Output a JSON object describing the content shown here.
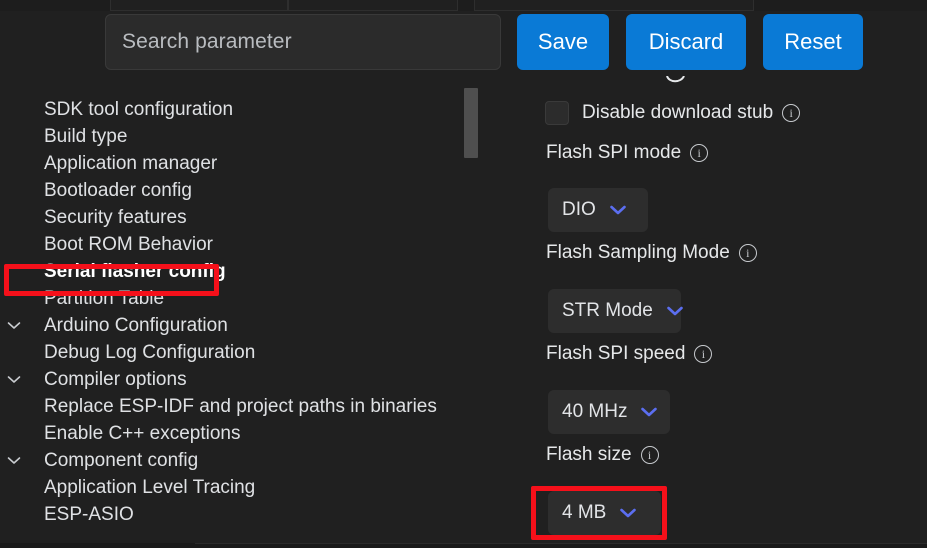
{
  "window": {
    "background": "#202020",
    "accent_blue": "#0a7ad6",
    "chevron_blue": "#5b6ef0",
    "annotation_red": "#f5101a"
  },
  "search": {
    "placeholder": "Search parameter",
    "value": ""
  },
  "toolbar": {
    "save_label": "Save",
    "discard_label": "Discard",
    "reset_label": "Reset"
  },
  "sidebar": {
    "items": [
      {
        "label": "SDK tool configuration",
        "level": 1,
        "twisty": "none",
        "selected": false
      },
      {
        "label": "Build type",
        "level": 1,
        "twisty": "none",
        "selected": false
      },
      {
        "label": "Application manager",
        "level": 1,
        "twisty": "none",
        "selected": false
      },
      {
        "label": "Bootloader config",
        "level": 1,
        "twisty": "none",
        "selected": false
      },
      {
        "label": "Security features",
        "level": 1,
        "twisty": "none",
        "selected": false
      },
      {
        "label": "Boot ROM Behavior",
        "level": 1,
        "twisty": "none",
        "selected": false
      },
      {
        "label": "Serial flasher config",
        "level": 1,
        "twisty": "none",
        "selected": true
      },
      {
        "label": "Partition Table",
        "level": 1,
        "twisty": "none",
        "selected": false
      },
      {
        "label": "Arduino Configuration",
        "level": 0,
        "twisty": "chevron-down",
        "selected": false
      },
      {
        "label": "Debug Log Configuration",
        "level": 1,
        "twisty": "none",
        "selected": false
      },
      {
        "label": "Compiler options",
        "level": 0,
        "twisty": "chevron-down",
        "selected": false
      },
      {
        "label": "Replace ESP-IDF and project paths in binaries",
        "level": 1,
        "twisty": "none",
        "selected": false
      },
      {
        "label": "Enable C++ exceptions",
        "level": 1,
        "twisty": "none",
        "selected": false
      },
      {
        "label": "Component config",
        "level": 0,
        "twisty": "chevron-down",
        "selected": false
      },
      {
        "label": "Application Level Tracing",
        "level": 1,
        "twisty": "none",
        "selected": false
      },
      {
        "label": "ESP-ASIO",
        "level": 1,
        "twisty": "none",
        "selected": false
      }
    ]
  },
  "settings": {
    "disable_download_stub": {
      "label": "Disable download stub",
      "checked": false,
      "info": "i"
    },
    "flash_spi_mode": {
      "label": "Flash SPI mode",
      "value": "DIO",
      "info": "i"
    },
    "flash_sampling_mode": {
      "label": "Flash Sampling Mode",
      "value": "STR Mode",
      "info": "i"
    },
    "flash_spi_speed": {
      "label": "Flash SPI speed",
      "value": "40 MHz",
      "info": "i"
    },
    "flash_size": {
      "label": "Flash size",
      "value": "4 MB",
      "info": "i"
    }
  },
  "annotations": [
    {
      "name": "serial-flasher-config-highlight",
      "target": "Serial flasher config"
    },
    {
      "name": "flash-size-dropdown-highlight",
      "target": "4 MB"
    }
  ]
}
